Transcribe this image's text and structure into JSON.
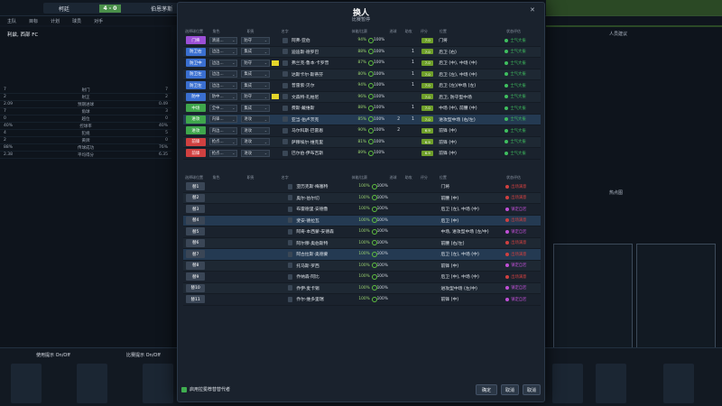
{
  "match": {
    "home": "柯廷",
    "score": "4 - 0",
    "away": "伯恩茅斯",
    "nav": [
      "主队",
      "目标",
      "计划",
      "球员",
      "对手"
    ]
  },
  "modal": {
    "title": "换人",
    "subtitle": "比赛暂停",
    "lineup_headers": [
      "选择球位置",
      "角色",
      "职责",
      "名字",
      "体能/比赛",
      "进球",
      "助攻",
      "评分",
      "位置",
      "状态评估"
    ],
    "sub_headers": [
      "选择球位置",
      "角色",
      "职责",
      "名字",
      "体能/比赛",
      "进球",
      "助攻",
      "评分",
      "位置",
      "状态评估"
    ],
    "lineup": [
      {
        "pos": "门将",
        "pos_color": "#9b4fd6",
        "role": "清道…",
        "duty": "防守",
        "name": "阿弗·亚伯",
        "fit": "94%",
        "match": "100%",
        "goals": "",
        "assists": "",
        "rating": "7.0",
        "position": "门将",
        "morale": "士气大振",
        "morale_color": "#3fbf5f"
      },
      {
        "pos": "防卫右",
        "pos_color": "#3a6fd0",
        "role": "边边…",
        "duty": "集成",
        "name": "迪迪斯·德罗巴",
        "fit": "88%",
        "match": "100%",
        "goals": "",
        "assists": "1",
        "rating": "7.0",
        "position": "后卫 (右)",
        "morale": "士气大振",
        "morale_color": "#3fbf5f"
      },
      {
        "pos": "防卫中",
        "pos_color": "#3a6fd0",
        "role": "边边…",
        "duty": "防守",
        "name": "弗兰克·鲁本·卡罗普",
        "fit": "87%",
        "match": "100%",
        "goals": "",
        "assists": "1",
        "rating": "7.0",
        "position": "后卫 (中), 中场 (中)",
        "morale": "士气大振",
        "morale_color": "#3fbf5f"
      },
      {
        "pos": "防卫左",
        "pos_color": "#3a6fd0",
        "role": "边边…",
        "duty": "集成",
        "name": "达斯卡尔·斯蒂芬",
        "fit": "80%",
        "match": "100%",
        "goals": "",
        "assists": "1",
        "rating": "7.0",
        "position": "后卫 (左), 中场 (中)",
        "morale": "士气大振",
        "morale_color": "#3fbf5f"
      },
      {
        "pos": "防卫左",
        "pos_color": "#3a6fd0",
        "role": "边边…",
        "duty": "集成",
        "name": "普雷索·贝尔",
        "fit": "94%",
        "match": "100%",
        "goals": "",
        "assists": "1",
        "rating": "7.0",
        "position": "后卫 (左)/中场 (左)",
        "morale": "士气大振",
        "morale_color": "#3fbf5f"
      },
      {
        "pos": "防中",
        "pos_color": "#3a6fd0",
        "role": "防中…",
        "duty": "防守",
        "name": "文森特·孔帕尼",
        "fit": "96%",
        "match": "100%",
        "goals": "",
        "assists": "",
        "rating": "7.0",
        "position": "后卫, 防守型中场",
        "morale": "士气大振",
        "morale_color": "#3fbf5f"
      },
      {
        "pos": "中场",
        "pos_color": "#3fa64c",
        "role": "全中…",
        "duty": "集成",
        "name": "费斯·戴维斯",
        "fit": "88%",
        "match": "100%",
        "goals": "",
        "assists": "1",
        "rating": "7.0",
        "position": "中场 (中), 前腰 (中)",
        "morale": "士气大振",
        "morale_color": "#3fbf5f"
      },
      {
        "pos": "进攻",
        "pos_color": "#3fa64c",
        "role": "内锋…",
        "duty": "进攻",
        "name": "亚当·伯卢茨克",
        "fit": "85%",
        "match": "100%",
        "goals": "2",
        "assists": "1",
        "rating": "7.0",
        "position": "进攻型中场 (右/左)",
        "morale": "士气大振",
        "morale_color": "#3fbf5f"
      },
      {
        "pos": "进攻",
        "pos_color": "#3fa64c",
        "role": "内边…",
        "duty": "进攻",
        "name": "马尔科斯·巴雷恩",
        "fit": "90%",
        "match": "100%",
        "goals": "2",
        "assists": "",
        "rating": "6.9",
        "position": "前锋 (中)",
        "morale": "士气大振",
        "morale_color": "#3fbf5f"
      },
      {
        "pos": "前锋",
        "pos_color": "#d04040",
        "role": "抢点…",
        "duty": "进攻",
        "name": "萨穆埃尔·维克里",
        "fit": "81%",
        "match": "100%",
        "goals": "",
        "assists": "",
        "rating": "6.9",
        "position": "前锋 (中)",
        "morale": "士气大振",
        "morale_color": "#3fbf5f"
      },
      {
        "pos": "前锋",
        "pos_color": "#d04040",
        "role": "抢点…",
        "duty": "进攻",
        "name": "巴尔伯·伊布吉斯",
        "fit": "89%",
        "match": "100%",
        "goals": "",
        "assists": "",
        "rating": "6.9",
        "position": "前锋 (中)",
        "morale": "士气大振",
        "morale_color": "#3fbf5f"
      }
    ],
    "subs": [
      {
        "pos": "替1",
        "name": "亚历克斯·梅塞特",
        "fit": "100%",
        "match": "100%",
        "position": "门将",
        "morale": "出场满意",
        "morale_color": "#d04040"
      },
      {
        "pos": "替2",
        "name": "奥尔·伯尔切",
        "fit": "100%",
        "match": "100%",
        "position": "前腰 (中)",
        "morale": "出场满意",
        "morale_color": "#d04040"
      },
      {
        "pos": "替3",
        "name": "布雷德里·安德鲁",
        "fit": "100%",
        "match": "100%",
        "position": "后卫 (左), 中场 (中)",
        "morale": "镇定自若",
        "morale_color": "#c04fd6"
      },
      {
        "pos": "替4",
        "name": "斐安·德拉瓦",
        "fit": "100%",
        "match": "100%",
        "position": "后卫 (中)",
        "morale": "出场满意",
        "morale_color": "#d04040"
      },
      {
        "pos": "替5",
        "name": "阿奇·本西蒙-安德森",
        "fit": "100%",
        "match": "100%",
        "position": "中场, 进攻型中场 (左/中)",
        "morale": "镇定自若",
        "morale_color": "#c04fd6"
      },
      {
        "pos": "替6",
        "name": "阿尔穆·奥伯斯特",
        "fit": "100%",
        "match": "100%",
        "position": "前腰 (右/左)",
        "morale": "出场满意",
        "morale_color": "#d04040"
      },
      {
        "pos": "替7",
        "name": "阿古拉斯·奥德蒙",
        "fit": "100%",
        "match": "100%",
        "position": "后卫 (左), 中场 (中)",
        "morale": "出场满意",
        "morale_color": "#d04040"
      },
      {
        "pos": "替8",
        "name": "托马斯·罗西",
        "fit": "100%",
        "match": "100%",
        "position": "前锋 (中)",
        "morale": "镇定自若",
        "morale_color": "#c04fd6"
      },
      {
        "pos": "替9",
        "name": "乔纳森·阿比",
        "fit": "100%",
        "match": "100%",
        "position": "后卫 (中), 中场 (中)",
        "morale": "出场满意",
        "morale_color": "#d04040"
      },
      {
        "pos": "替10",
        "name": "乔伊·麦卡锡",
        "fit": "100%",
        "match": "100%",
        "position": "进攻型中场 (左/中)",
        "morale": "镇定自若",
        "morale_color": "#c04fd6"
      },
      {
        "pos": "替11",
        "name": "乔尔·维多里瑞",
        "fit": "100%",
        "match": "100%",
        "position": "前锋 (中)",
        "morale": "镇定自若",
        "morale_color": "#c04fd6"
      }
    ],
    "footer_check": "启用拉冕荐替替代者",
    "buttons": {
      "confirm": "确定",
      "cancel": "取消",
      "close": "取消"
    }
  },
  "left_panel": {
    "team_name": "利兹, 西部 FC",
    "stats": [
      {
        "l": "7",
        "m": "射门",
        "r": "7"
      },
      {
        "l": "2",
        "m": "射正",
        "r": "2"
      },
      {
        "l": "2.09",
        "m": "预期进球",
        "r": "0.49"
      },
      {
        "l": "7",
        "m": "角球",
        "r": "3"
      },
      {
        "l": "0",
        "m": "越位",
        "r": "0"
      },
      {
        "l": "40%",
        "m": "控球率",
        "r": "40%"
      },
      {
        "l": "4",
        "m": "犯规",
        "r": "5"
      },
      {
        "l": "2",
        "m": "黄牌",
        "r": "0"
      },
      {
        "l": "88%",
        "m": "传球成功",
        "r": "76%"
      },
      {
        "l": "2.38",
        "m": "平均得分",
        "r": "6.35"
      }
    ]
  },
  "right_panel": {
    "title": "人员建议",
    "heatmap_title": "热点图"
  },
  "bottom": {
    "toggle1": "使用提示 On/Off",
    "toggle2": "比赛提示 On/Off"
  }
}
